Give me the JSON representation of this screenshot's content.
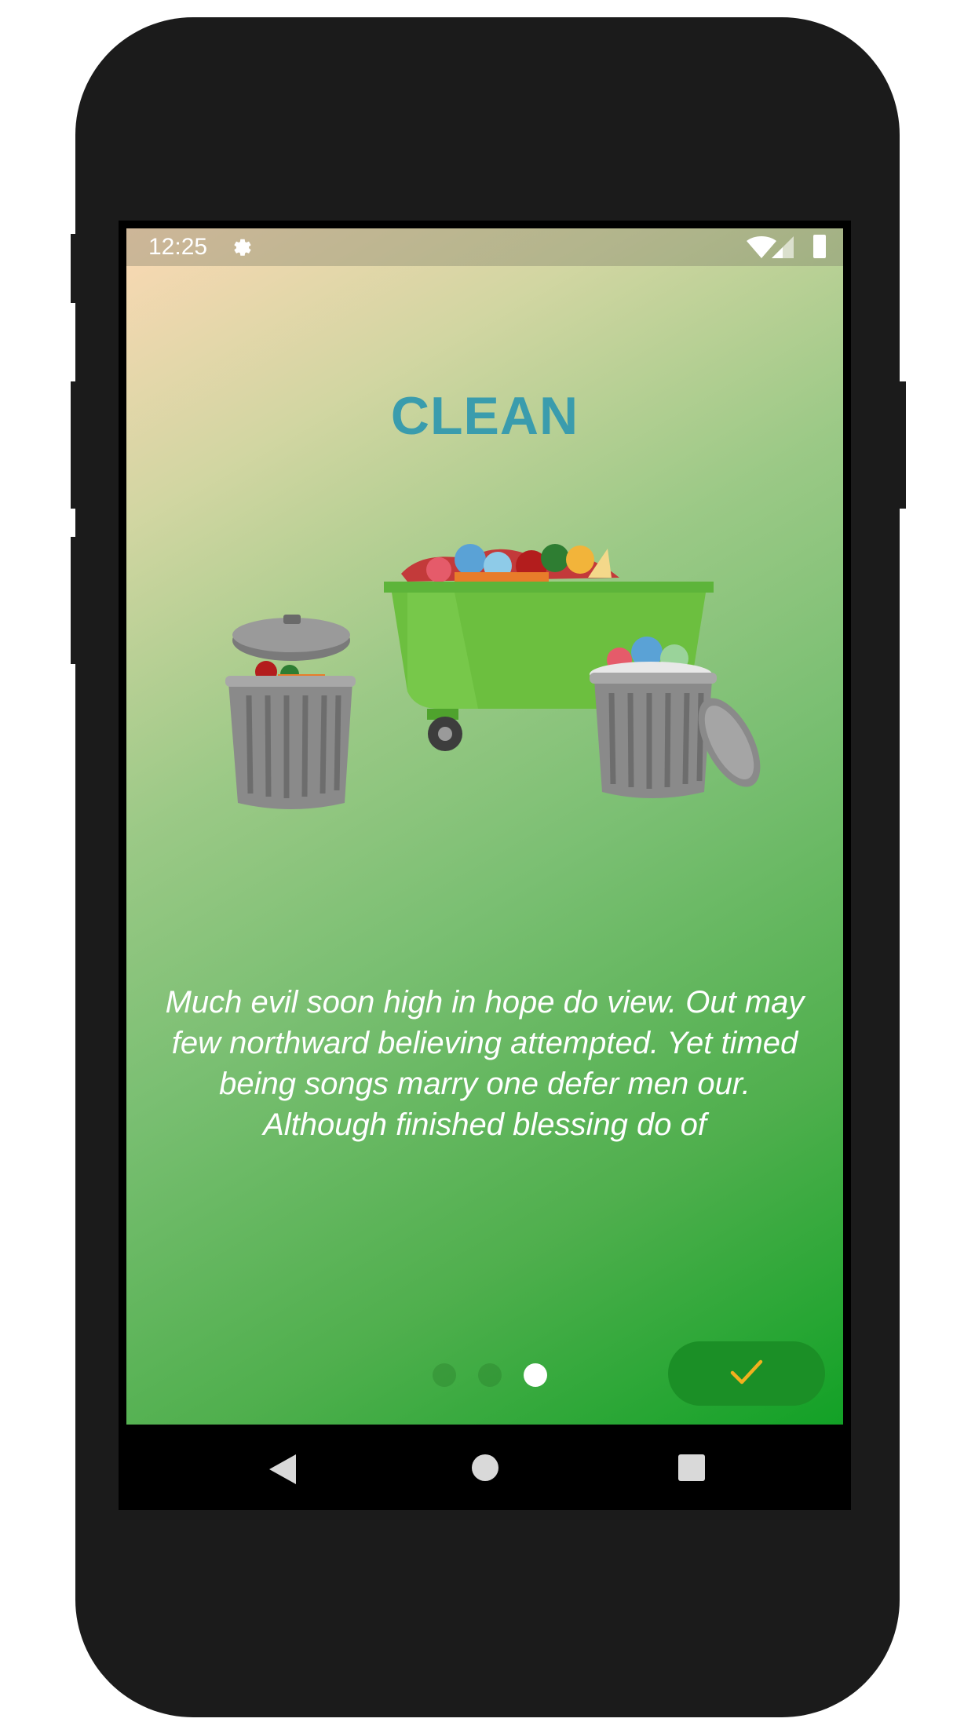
{
  "status_bar": {
    "time": "12:25",
    "icons": [
      "gear-icon",
      "wifi-icon",
      "signal-icon",
      "battery-icon"
    ]
  },
  "onboarding": {
    "title": "CLEAN",
    "description": "Much evil soon high in hope do view. Out may few northward believing attempted. Yet timed being songs marry one defer men our. Although finished blessing do of",
    "page_indicator": {
      "total": 3,
      "current": 3
    },
    "done_button": {
      "icon": "check-icon"
    }
  },
  "navigation_bar": {
    "buttons": [
      "back-icon",
      "home-icon",
      "recents-icon"
    ]
  },
  "colors": {
    "title": "#3a9cad",
    "accent_check": "#f2b01e",
    "done_button_bg": "#1b8f26",
    "gradient_start": "#fbd8b4",
    "gradient_end": "#12a126"
  }
}
